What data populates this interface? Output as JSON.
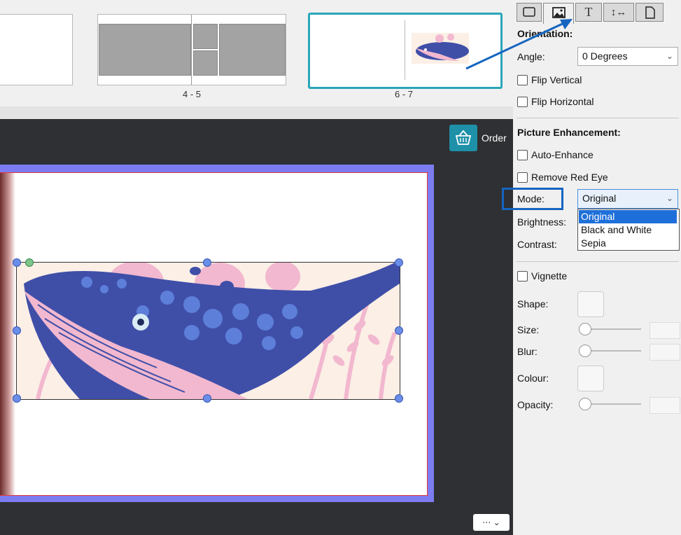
{
  "thumbnails": {
    "spread1_label": "4 - 5",
    "spread2_label": "6 - 7"
  },
  "canvas": {
    "order_label": "Order",
    "more_label": "⋯ ⌄"
  },
  "panel": {
    "tabs": [
      {
        "name": "frame-tab",
        "icon": "frame-icon"
      },
      {
        "name": "image-tab",
        "icon": "image-icon"
      },
      {
        "name": "text-tab",
        "icon": "text-icon"
      },
      {
        "name": "spacing-tab",
        "icon": "spacing-icon"
      },
      {
        "name": "page-tab",
        "icon": "page-icon"
      }
    ],
    "tab_text_glyph": "T",
    "tab_spacing_glyph": "↕↔",
    "orientation_heading": "Orientation:",
    "angle_label": "Angle:",
    "angle_value": "0 Degrees",
    "flip_vertical": "Flip Vertical",
    "flip_horizontal": "Flip Horizontal",
    "enhancement_heading": "Picture Enhancement:",
    "auto_enhance": "Auto-Enhance",
    "remove_red_eye": "Remove Red Eye",
    "mode_label": "Mode:",
    "mode_value": "Original",
    "mode_options": [
      "Original",
      "Black and White",
      "Sepia"
    ],
    "brightness_label": "Brightness:",
    "contrast_label": "Contrast:",
    "vignette": "Vignette",
    "shape_label": "Shape:",
    "size_label": "Size:",
    "blur_label": "Blur:",
    "colour_label": "Colour:",
    "opacity_label": "Opacity:"
  },
  "colors": {
    "accent_blue": "#1565c0",
    "order_teal": "#1e90a8",
    "page_border": "#7c7cf0",
    "whale_blue": "#3f4fa8",
    "whale_pink": "#f2b8cf"
  }
}
